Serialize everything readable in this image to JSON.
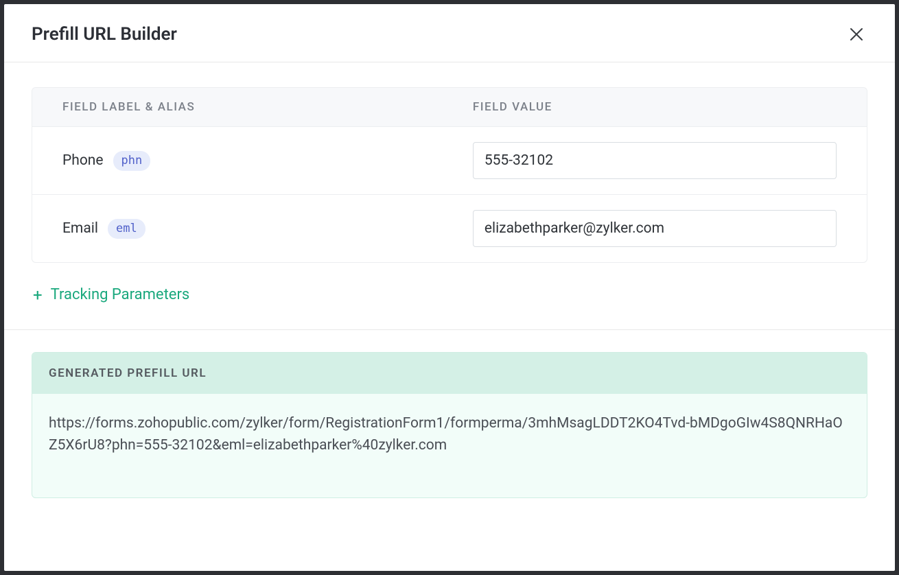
{
  "modal": {
    "title": "Prefill URL Builder"
  },
  "table": {
    "header_label": "FIELD LABEL & ALIAS",
    "header_value": "FIELD VALUE",
    "rows": [
      {
        "label": "Phone",
        "alias": "phn",
        "value": "555-32102"
      },
      {
        "label": "Email",
        "alias": "eml",
        "value": "elizabethparker@zylker.com"
      }
    ]
  },
  "tracking": {
    "label": "Tracking Parameters"
  },
  "generated": {
    "header": "GENERATED PREFILL URL",
    "url": "https://forms.zohopublic.com/zylker/form/RegistrationForm1/formperma/3mhMsagLDDT2KO4Tvd-bMDgoGIw4S8QNRHaOZ5X6rU8?phn=555-32102&eml=elizabethparker%40zylker.com"
  }
}
